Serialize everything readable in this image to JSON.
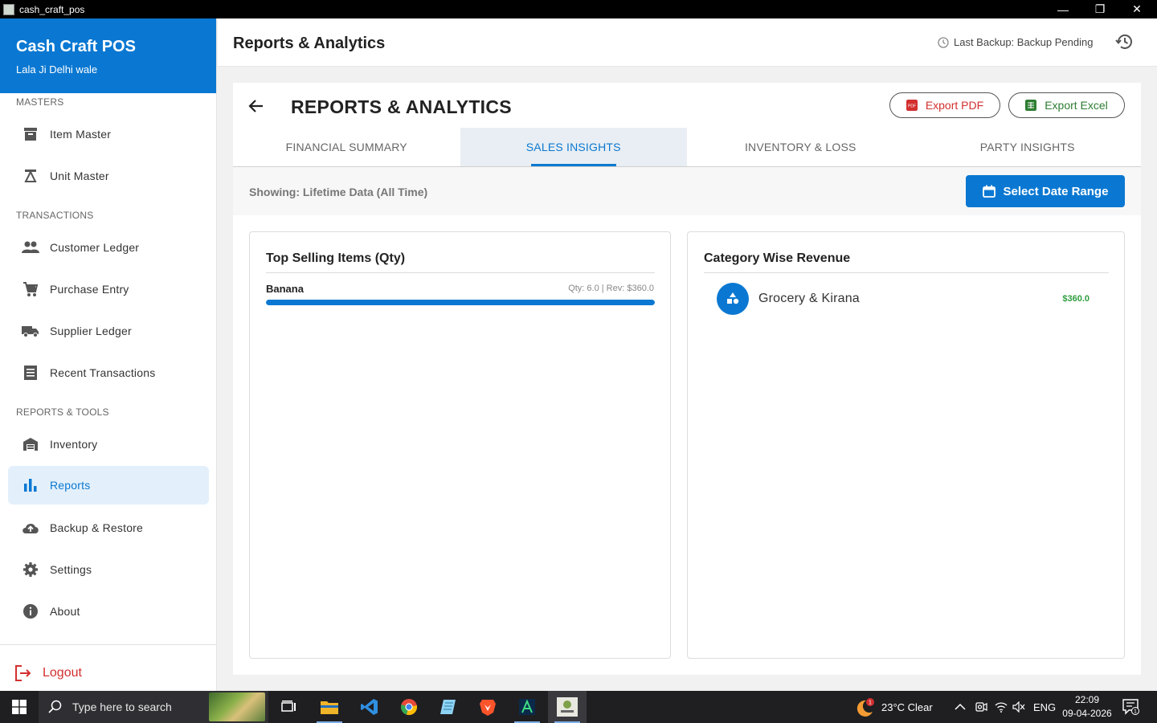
{
  "window": {
    "title": "cash_craft_pos",
    "minimize": "—",
    "restore": "❐",
    "close": "✕"
  },
  "sidebar": {
    "brand_name": "Cash Craft POS",
    "brand_sub": "Lala Ji Delhi wale",
    "sections": {
      "masters": "MASTERS",
      "transactions": "TRANSACTIONS",
      "reports_tools": "REPORTS & TOOLS"
    },
    "items": [
      {
        "label": "Item Master",
        "icon": "archive-box-icon"
      },
      {
        "label": "Unit Master",
        "icon": "scale-icon"
      },
      {
        "label": "Customer Ledger",
        "icon": "people-icon"
      },
      {
        "label": "Purchase Entry",
        "icon": "cart-icon"
      },
      {
        "label": "Supplier Ledger",
        "icon": "truck-icon"
      },
      {
        "label": "Recent Transactions",
        "icon": "receipt-list-icon"
      },
      {
        "label": "Inventory",
        "icon": "warehouse-icon"
      },
      {
        "label": "Reports",
        "icon": "bar-chart-icon",
        "active": true
      },
      {
        "label": "Backup & Restore",
        "icon": "cloud-upload-icon"
      },
      {
        "label": "Settings",
        "icon": "gear-icon"
      },
      {
        "label": "About",
        "icon": "info-icon"
      }
    ],
    "logout": "Logout"
  },
  "header": {
    "title": "Reports & Analytics",
    "backup_status": "Last Backup: Backup Pending"
  },
  "panel": {
    "title": "REPORTS & ANALYTICS",
    "export_pdf": "Export PDF",
    "export_excel": "Export Excel",
    "tabs": [
      {
        "label": "FINANCIAL SUMMARY"
      },
      {
        "label": "SALES INSIGHTS",
        "active": true
      },
      {
        "label": "INVENTORY & LOSS"
      },
      {
        "label": "PARTY INSIGHTS"
      }
    ],
    "showing": "Showing: Lifetime Data (All Time)",
    "date_range_button": "Select Date Range"
  },
  "top_selling": {
    "title": "Top Selling Items (Qty)",
    "items": [
      {
        "name": "Banana",
        "meta": "Qty: 6.0  |  Rev: $360.0",
        "share": 1.0
      }
    ]
  },
  "category_revenue": {
    "title": "Category Wise Revenue",
    "items": [
      {
        "name": "Grocery & Kirana",
        "value": "$360.0"
      }
    ]
  },
  "taskbar": {
    "search_placeholder": "Type here to search",
    "weather": "23°C  Clear",
    "weather_badge": "1",
    "language": "ENG",
    "time": "22:09",
    "date": "09-04-2026",
    "notification_count": "1"
  },
  "colors": {
    "primary": "#0a78d2",
    "danger": "#d32f2f",
    "success": "#2e7d32",
    "revenue_green": "#2e9e3e"
  }
}
